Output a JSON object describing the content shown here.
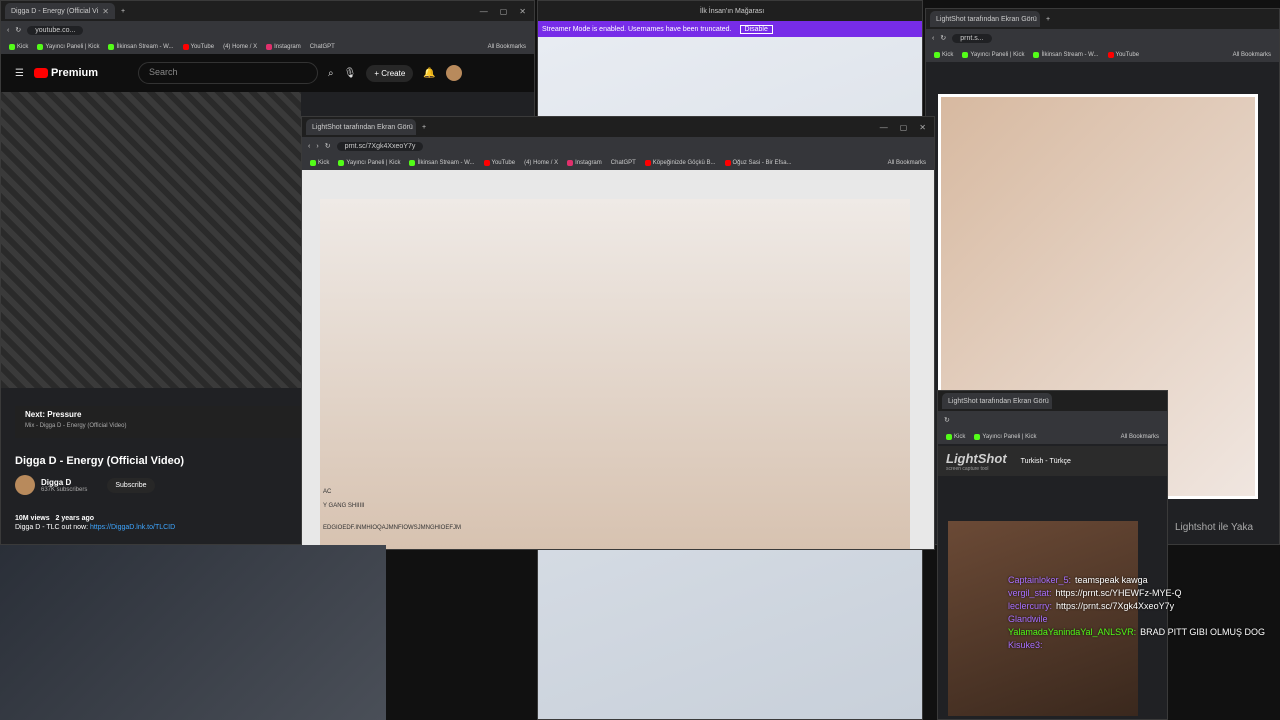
{
  "youtube_window": {
    "tab_title": "Digga D - Energy (Official Vi",
    "url": "youtube.co...",
    "header": {
      "logo": "Premium",
      "search_placeholder": "Search",
      "create_label": "Create"
    },
    "up_next": {
      "label": "Next: Pressure",
      "subtitle": "Mix - Digga D - Energy (Official Video)"
    },
    "video_title": "Digga D - Energy (Official Video)",
    "channel": {
      "name": "Digga D",
      "subscribers": "637K subscribers",
      "subscribe_label": "Subscribe"
    },
    "meta": {
      "views": "10M views",
      "ago": "2 years ago"
    },
    "description": {
      "prefix": "Digga D - TLC out now:",
      "link": "https://DiggaD.lnk.to/TLCID"
    }
  },
  "center_window": {
    "tab_title": "İlk İnsan'ın Mağarası",
    "banner": {
      "text": "Streamer Mode is enabled. Usernames have been truncated.",
      "button": "Disable"
    }
  },
  "lightshot_window": {
    "tab_title": "LightShot tarafından Ekran Görü",
    "url": "prnt.sc/7Xgk4XxeoY7y",
    "bookmarks": [
      "Kick",
      "Yayıncı Paneli | Kick",
      "İlkinsan Stream - W...",
      "YouTube",
      "(4) Home / X",
      "Instagram",
      "ChatGPT",
      "Köpeğinizde Göçkü B...",
      "Oğuz Sasi - Bir Efsa..."
    ],
    "all_bookmarks": "All Bookmarks",
    "overlay_text": [
      "AC",
      "Y GANG SHIIIII",
      "EDGIOEDF.INMHIOQAJMNFIOWSJMNGHIOEFJM"
    ]
  },
  "main_bookmarks": {
    "items": [
      "Kick",
      "Yayıncı Paneli | Kick",
      "İlkinsan Stream - W...",
      "YouTube",
      "(4) Home / X",
      "Instagram",
      "ChatGPT"
    ],
    "all_bookmarks": "All Bookmarks"
  },
  "right_window": {
    "tab_title": "LightShot tarafından Ekran Görü",
    "url": "prnt.s...",
    "bookmarks": [
      "Kick",
      "Yayıncı Paneli | Kick",
      "İlkinsan Stream - W...",
      "YouTube"
    ],
    "all_bookmarks": "All Bookmarks"
  },
  "small_window": {
    "tab_title": "LightShot tarafından Ekran Görü",
    "bookmarks": [
      "Kick",
      "Yayıncı Paneli | Kick"
    ],
    "all_bookmarks": "All Bookmarks",
    "logo": "LightShot",
    "logo_sub": "screen capture tool",
    "language": "Turkish - Türkçe",
    "side_text": "Lightshot ile Yaka"
  },
  "chat": [
    {
      "user": "Captainloker_5:",
      "text": "teamspeak kawga"
    },
    {
      "user": "vergil_stat:",
      "text": "https://prnt.sc/YHEWFz-MYE-Q"
    },
    {
      "user": "leclercurry:",
      "text": "https://prnt.sc/7Xgk4XxeoY7y"
    },
    {
      "user": "Glandwile",
      "text": ""
    },
    {
      "user": "YalamadaYanindaYal_ANLSVR:",
      "text": "BRAD PITT GIBI OLMUŞ DOG"
    },
    {
      "user": "Kisuke3:",
      "text": ""
    }
  ],
  "colors": {
    "accent": "#9147ff",
    "yt_red": "#ff0000",
    "kick_green": "#53fc18"
  }
}
